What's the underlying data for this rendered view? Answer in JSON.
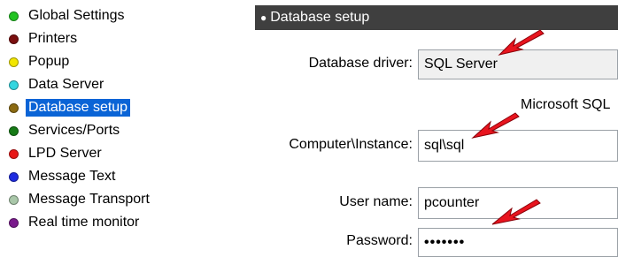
{
  "sidebar": {
    "items": [
      {
        "label": "Global Settings",
        "color": "#22c322"
      },
      {
        "label": "Printers",
        "color": "#7a0f0f"
      },
      {
        "label": "Popup",
        "color": "#f2e600"
      },
      {
        "label": "Data Server",
        "color": "#33d6e0"
      },
      {
        "label": "Database setup",
        "color": "#8b6a12",
        "selected": true
      },
      {
        "label": "Services/Ports",
        "color": "#167a16"
      },
      {
        "label": "LPD Server",
        "color": "#e81818"
      },
      {
        "label": "Message Text",
        "color": "#1e2be0"
      },
      {
        "label": "Message Transport",
        "color": "#a9c7a9"
      },
      {
        "label": "Real time monitor",
        "color": "#7a1a8c"
      }
    ],
    "selected_color": "#0a64d6"
  },
  "panel": {
    "title": "Database setup",
    "title_bullet": "●",
    "database_driver": {
      "label": "Database driver:",
      "value": "SQL Server"
    },
    "driver_note": "Microsoft SQL",
    "computer_instance": {
      "label": "Computer\\Instance:",
      "value": "sql\\sql"
    },
    "user_name": {
      "label": "User name:",
      "value": "pcounter"
    },
    "password": {
      "label": "Password:",
      "value": "•••••••"
    }
  },
  "annotation_color": "#e8141e"
}
